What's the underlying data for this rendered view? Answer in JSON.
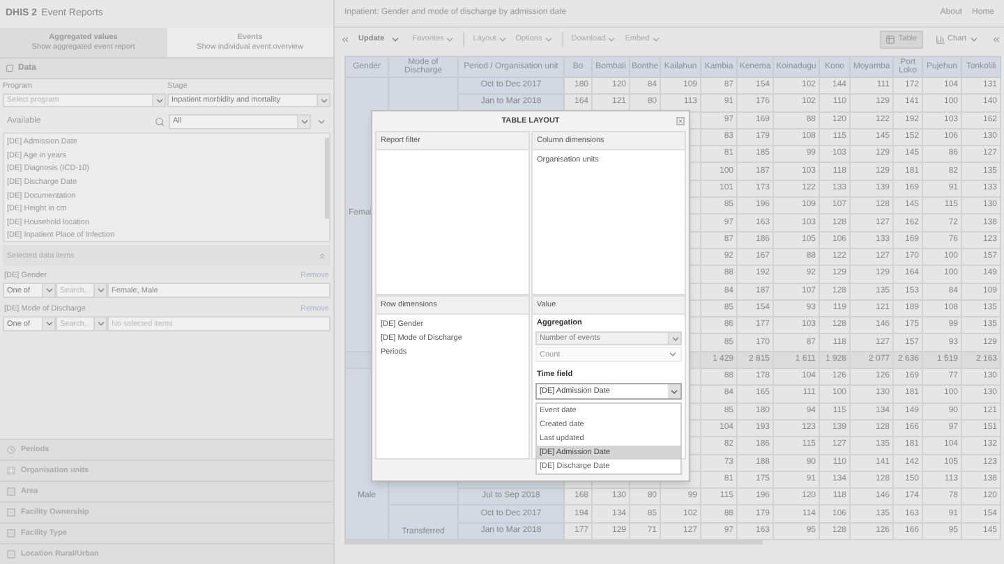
{
  "app": {
    "logo": "DHIS 2",
    "title": "Event Reports"
  },
  "mode_tabs": [
    {
      "label": "Aggregated values",
      "sublabel": "Show aggregated event report",
      "selected": true
    },
    {
      "label": "Events",
      "sublabel": "Show individual event overview",
      "selected": false
    }
  ],
  "data_section": {
    "title": "Data",
    "program": {
      "label": "Program",
      "placeholder": "Select program"
    },
    "stage": {
      "label": "Stage",
      "value": "Inpatient morbidity and mortality"
    },
    "available": {
      "label": "Available",
      "filter": "All",
      "items": [
        "[DE] Admission Date",
        "[DE] Age in years",
        "[DE] Diagnosis (ICD-10)",
        "[DE] Discharge Date",
        "[DE] Documentation",
        "[DE] Height in cm",
        "[DE] Household location",
        "[DE] Inpatient Place of Infection"
      ]
    },
    "selected_header": "Selected data items",
    "selected_items": [
      {
        "name": "[DE] Gender",
        "remove": "Remove",
        "operator": "One of",
        "search_placeholder": "Search..",
        "value": "Female, Male"
      },
      {
        "name": "[DE] Mode of Discharge",
        "remove": "Remove",
        "operator": "One of",
        "search_placeholder": "Search..",
        "values_placeholder": "No selected items"
      }
    ]
  },
  "sections": [
    {
      "title": "Periods",
      "kind": "clock"
    },
    {
      "title": "Organisation units",
      "kind": "tree"
    },
    {
      "title": "Area",
      "kind": "group"
    },
    {
      "title": "Facility Ownership",
      "kind": "group"
    },
    {
      "title": "Facility Type",
      "kind": "group"
    },
    {
      "title": "Location Rural/Urban",
      "kind": "group"
    }
  ],
  "report_title": "Inpatient: Gender and mode of discharge by admission date",
  "nav_links": [
    "About",
    "Home"
  ],
  "toolbar": [
    {
      "label": "Update",
      "kind": "primary",
      "divider_before": false
    },
    {
      "label": "Favorites",
      "kind": "menu",
      "divider_before": false
    },
    {
      "label": "Layout",
      "kind": "menu",
      "divider_before": true
    },
    {
      "label": "Options",
      "kind": "menu",
      "divider_before": false
    },
    {
      "label": "Download",
      "kind": "menu",
      "divider_before": true
    },
    {
      "label": "Embed",
      "kind": "menu",
      "divider_before": false
    }
  ],
  "view_buttons": [
    {
      "label": "Table",
      "selected": true,
      "kind": "table"
    },
    {
      "label": "Chart",
      "selected": false,
      "kind": "chart"
    }
  ],
  "table": {
    "columns": [
      "Gender",
      "Mode of Discharge",
      "Period / Organisation unit",
      "Bo",
      "Bombali",
      "Bonthe",
      "Kailahun",
      "Kambia",
      "Kenema",
      "Koinadugu",
      "Kono",
      "Moyamba",
      "Port Loko",
      "Pujehun",
      "Tonkolili"
    ],
    "rows": [
      {
        "kind": "data",
        "gender": "Femal",
        "period": "Oct to Dec 2017",
        "left_values": [
          "180",
          "120",
          "84",
          "109"
        ],
        "values": [
          "87",
          "154",
          "102",
          "144",
          "111",
          "172",
          "104",
          "131"
        ]
      },
      {
        "kind": "data",
        "period": "Jan to Mar 2018",
        "left_values": [
          "164",
          "121",
          "80",
          "113"
        ],
        "values": [
          "91",
          "176",
          "102",
          "110",
          "129",
          "141",
          "100",
          "140"
        ]
      },
      {
        "kind": "data",
        "values": [
          "97",
          "169",
          "88",
          "120",
          "122",
          "192",
          "103",
          "162"
        ]
      },
      {
        "kind": "data",
        "values": [
          "83",
          "179",
          "108",
          "115",
          "145",
          "152",
          "106",
          "130"
        ]
      },
      {
        "kind": "data",
        "values": [
          "81",
          "185",
          "99",
          "103",
          "129",
          "145",
          "86",
          "127"
        ]
      },
      {
        "kind": "data",
        "values": [
          "100",
          "187",
          "103",
          "118",
          "129",
          "181",
          "82",
          "135"
        ]
      },
      {
        "kind": "data",
        "values": [
          "101",
          "173",
          "122",
          "133",
          "139",
          "169",
          "91",
          "133"
        ]
      },
      {
        "kind": "data",
        "values": [
          "85",
          "196",
          "109",
          "107",
          "128",
          "145",
          "115",
          "130"
        ]
      },
      {
        "kind": "data",
        "values": [
          "97",
          "163",
          "103",
          "128",
          "127",
          "162",
          "72",
          "138"
        ]
      },
      {
        "kind": "data",
        "values": [
          "87",
          "186",
          "105",
          "106",
          "133",
          "169",
          "76",
          "123"
        ]
      },
      {
        "kind": "data",
        "values": [
          "92",
          "167",
          "88",
          "122",
          "127",
          "170",
          "100",
          "157"
        ]
      },
      {
        "kind": "data",
        "values": [
          "88",
          "192",
          "92",
          "129",
          "129",
          "164",
          "100",
          "149"
        ]
      },
      {
        "kind": "data",
        "values": [
          "84",
          "187",
          "107",
          "128",
          "135",
          "153",
          "84",
          "109"
        ]
      },
      {
        "kind": "data",
        "values": [
          "85",
          "154",
          "93",
          "119",
          "121",
          "189",
          "108",
          "135"
        ]
      },
      {
        "kind": "data",
        "values": [
          "86",
          "177",
          "103",
          "128",
          "146",
          "175",
          "99",
          "135"
        ]
      },
      {
        "kind": "data",
        "values": [
          "85",
          "170",
          "87",
          "118",
          "127",
          "157",
          "93",
          "129"
        ]
      },
      {
        "kind": "total",
        "values": [
          "1 429",
          "2 815",
          "1 611",
          "1 928",
          "2 077",
          "2 636",
          "1 519",
          "2 163"
        ]
      },
      {
        "kind": "data",
        "gender": "Male",
        "values": [
          "88",
          "178",
          "104",
          "126",
          "126",
          "169",
          "77",
          "130"
        ]
      },
      {
        "kind": "data",
        "values": [
          "84",
          "165",
          "111",
          "100",
          "130",
          "181",
          "100",
          "130"
        ]
      },
      {
        "kind": "data",
        "values": [
          "85",
          "180",
          "94",
          "115",
          "134",
          "149",
          "90",
          "121"
        ]
      },
      {
        "kind": "data",
        "values": [
          "104",
          "193",
          "123",
          "139",
          "128",
          "166",
          "97",
          "151"
        ]
      },
      {
        "kind": "data",
        "values": [
          "82",
          "186",
          "115",
          "127",
          "135",
          "181",
          "104",
          "132"
        ]
      },
      {
        "kind": "data",
        "values": [
          "73",
          "188",
          "90",
          "110",
          "141",
          "142",
          "105",
          "123"
        ]
      },
      {
        "kind": "data",
        "values": [
          "81",
          "175",
          "91",
          "134",
          "128",
          "150",
          "113",
          "138"
        ]
      },
      {
        "kind": "data",
        "period": "Jul to Sep 2018",
        "left_values": [
          "168",
          "130",
          "80",
          "99"
        ],
        "values": [
          "115",
          "196",
          "120",
          "118",
          "146",
          "174",
          "78",
          "120"
        ]
      },
      {
        "kind": "data",
        "mode": "Transferred",
        "period": "Oct to Dec 2017",
        "left_values": [
          "194",
          "134",
          "85",
          "102"
        ],
        "values": [
          "88",
          "179",
          "114",
          "106",
          "135",
          "163",
          "91",
          "154"
        ]
      },
      {
        "kind": "data",
        "period": "Jan to Mar 2018",
        "left_values": [
          "177",
          "129",
          "71",
          "127"
        ],
        "values": [
          "97",
          "163",
          "95",
          "128",
          "126",
          "166",
          "95",
          "145"
        ]
      }
    ]
  },
  "dialog": {
    "title": "TABLE LAYOUT",
    "filter": {
      "title": "Report filter"
    },
    "columns": {
      "title": "Column dimensions",
      "items": [
        "Organisation units"
      ]
    },
    "rows": {
      "title": "Row dimensions",
      "items": [
        "[DE] Gender",
        "[DE] Mode of Discharge",
        "Periods"
      ]
    },
    "value": {
      "title": "Value",
      "aggregation_label": "Aggregation",
      "aggregation": "Number of events",
      "value_type": {
        "value": "Count",
        "disabled": true
      },
      "time_field_label": "Time field",
      "time_field": "[DE] Admission Date",
      "options": [
        {
          "label": "Event date",
          "selected": false
        },
        {
          "label": "Created date",
          "selected": false
        },
        {
          "label": "Last updated",
          "selected": false
        },
        {
          "label": "[DE] Admission Date",
          "selected": true
        },
        {
          "label": "[DE] Discharge Date",
          "selected": false
        }
      ]
    }
  }
}
